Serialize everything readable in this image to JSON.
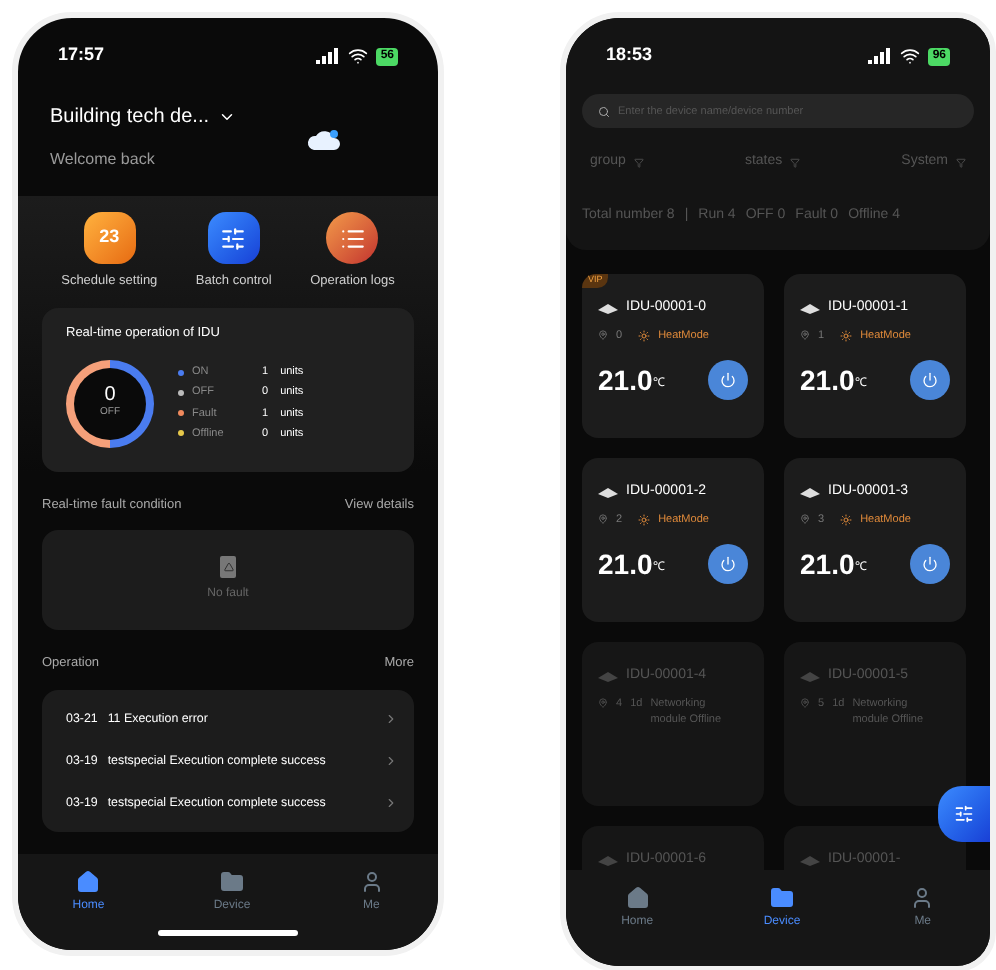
{
  "home_screen": {
    "status_bar": {
      "time": "17:57",
      "battery": "56"
    },
    "header": {
      "project": "Building tech de...",
      "greeting": "Welcome back"
    },
    "quick_actions": [
      {
        "kind": "calendar",
        "label": "Schedule setting",
        "badge": "23"
      },
      {
        "kind": "sliders",
        "label": "Batch control"
      },
      {
        "kind": "list",
        "label": "Operation logs"
      }
    ],
    "idu_card": {
      "title": "Real-time operation of IDU",
      "donut_value": "0",
      "donut_label": "OFF",
      "legend": [
        {
          "name": "ON",
          "color": "#4a7cf0",
          "count": "1",
          "unit": "units"
        },
        {
          "name": "OFF",
          "color": "#bbbbbb",
          "count": "0",
          "unit": "units"
        },
        {
          "name": "Fault",
          "color": "#f08a5d",
          "count": "1",
          "unit": "units"
        },
        {
          "name": "Offline",
          "color": "#e6c84a",
          "count": "0",
          "unit": "units"
        }
      ]
    },
    "fault": {
      "title": "Real-time fault condition",
      "link": "View details",
      "empty_text": "No fault"
    },
    "operation": {
      "title": "Operation",
      "link": "More",
      "items": [
        {
          "date": "03-21",
          "text": "11 Execution error"
        },
        {
          "date": "03-19",
          "text": "testspecial Execution complete success"
        },
        {
          "date": "03-19",
          "text": "testspecial Execution complete success"
        }
      ]
    },
    "tab_bar": [
      {
        "kind": "home",
        "label": "Home",
        "selected": true
      },
      {
        "kind": "device",
        "label": "Device",
        "selected": false
      },
      {
        "kind": "me",
        "label": "Me",
        "selected": false
      }
    ]
  },
  "device_screen": {
    "status_bar": {
      "time": "18:53",
      "battery": "96"
    },
    "search": {
      "placeholder": "Enter the device name/device number"
    },
    "filters": [
      "group",
      "states",
      "System"
    ],
    "totals": {
      "total": "Total number 8",
      "separator": "|",
      "counts": [
        "Run 4",
        "OFF 0",
        "Fault 0",
        "Offline 4"
      ]
    },
    "devices": [
      {
        "kind": "online",
        "name": "IDU-00001-0",
        "badge": "VIP",
        "index": "0",
        "mode": "HeatMode",
        "temperature": "21.0",
        "unit": "℃",
        "on": true
      },
      {
        "kind": "online",
        "name": "IDU-00001-1",
        "index": "1",
        "mode": "HeatMode",
        "temperature": "21.0",
        "unit": "℃",
        "on": true
      },
      {
        "kind": "online",
        "name": "IDU-00001-2",
        "index": "2",
        "mode": "HeatMode",
        "temperature": "21.0",
        "unit": "℃",
        "on": true
      },
      {
        "kind": "online",
        "name": "IDU-00001-3",
        "index": "3",
        "mode": "HeatMode",
        "temperature": "21.0",
        "unit": "℃",
        "on": true
      },
      {
        "kind": "offline",
        "name": "IDU-00001-4",
        "index": "4",
        "age": "1d",
        "status": "Networking module Offline"
      },
      {
        "kind": "offline",
        "name": "IDU-00001-5",
        "index": "5",
        "age": "1d",
        "status": "Networking module Offline"
      },
      {
        "kind": "offline",
        "name": "IDU-00001-6"
      },
      {
        "kind": "offline",
        "name": "IDU-00001-"
      }
    ],
    "tab_bar": [
      {
        "kind": "home",
        "label": "Home",
        "selected": false
      },
      {
        "kind": "device",
        "label": "Device",
        "selected": true
      },
      {
        "kind": "me",
        "label": "Me",
        "selected": false
      }
    ]
  }
}
